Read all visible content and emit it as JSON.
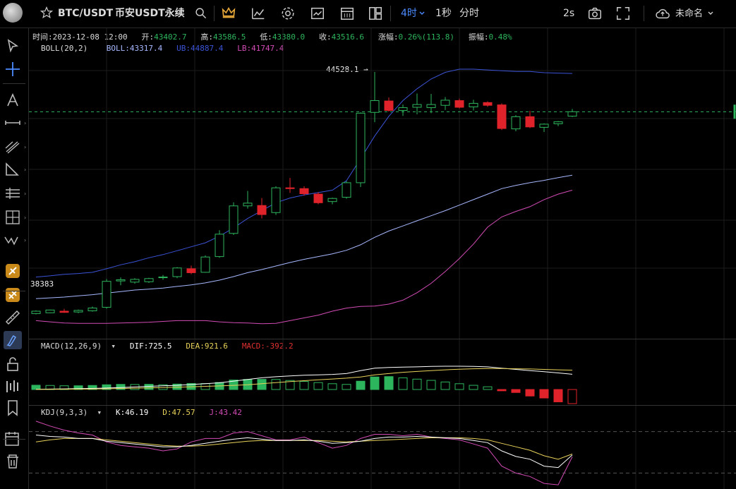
{
  "header": {
    "symbol": "BTC/USDT",
    "exchange": "币安USDT永续",
    "intervals": [
      {
        "label": "4时",
        "active": true,
        "has_dropdown": true
      },
      {
        "label": "1秒",
        "active": false
      },
      {
        "label": "分时",
        "active": false
      }
    ],
    "refresh": "2s",
    "layout_name": "未命名",
    "icons": [
      "star-icon",
      "search-icon",
      "crown-icon",
      "indicators-icon",
      "gear-icon",
      "chart-template-icon",
      "calendar-icon",
      "layout-icon",
      "camera-icon",
      "fullscreen-icon",
      "cloud-icon",
      "chevron-down-icon"
    ]
  },
  "ohlc": {
    "time_label": "时间:",
    "time": "2023-12-08 12:00",
    "open_label": "开:",
    "open": "43402.7",
    "high_label": "高:",
    "high": "43586.5",
    "low_label": "低:",
    "low": "43380.0",
    "close_label": "收:",
    "close": "43516.6",
    "change_label": "涨幅:",
    "change": "0.26%(113.8)",
    "amp_label": "振幅:",
    "amp": "0.48%"
  },
  "boll": {
    "name": "BOLL(20,2)",
    "mid": "BOLL:43317.4",
    "ub": "UB:44887.4",
    "lb": "LB:41747.4",
    "colors": {
      "mid": "#a7b8ff",
      "ub": "#3b53d6",
      "lb": "#d24bb5"
    }
  },
  "macd": {
    "name": "MACD(12,26,9)",
    "dif": "DIF:725.5",
    "dea": "DEA:921.6",
    "macd": "MACD:-392.2",
    "colors": {
      "dif": "#ffffff",
      "dea": "#e8d25a",
      "macd": "#e03030"
    }
  },
  "kdj": {
    "name": "KDJ(9,3,3)",
    "k": "K:46.19",
    "d": "D:47.57",
    "j": "J:43.42",
    "colors": {
      "k": "#ffffff",
      "d": "#e8d25a",
      "j": "#d24bb5"
    }
  },
  "annotations": {
    "high_mark": "44528.1",
    "low_mark": "38383"
  },
  "colors": {
    "up": "#2db55d",
    "down": "#e0222a",
    "bg": "#000000"
  },
  "left_tools": [
    "cursor-icon",
    "crosshair-icon",
    "text-icon",
    "line-icon",
    "multi-line-icon",
    "triangle-icon",
    "fib-icon",
    "gann-icon",
    "wave-icon",
    "magnet-icon",
    "magnet-strong-icon",
    "ruler-icon",
    "pen-icon",
    "lock-icon",
    "group-icon",
    "bookmark-icon",
    "calendar-edit-icon",
    "trash-icon"
  ],
  "chart_data": {
    "type": "candlestick",
    "series": [
      {
        "name": "candles",
        "values": [
          [
            38380,
            38460,
            38360,
            38440
          ],
          [
            38400,
            38480,
            38390,
            38470
          ],
          [
            38440,
            38500,
            38400,
            38410
          ],
          [
            38420,
            38480,
            38390,
            38460
          ],
          [
            38450,
            38560,
            38430,
            38520
          ],
          [
            38540,
            39260,
            38500,
            39200
          ],
          [
            39210,
            39300,
            39100,
            39240
          ],
          [
            39180,
            39280,
            39140,
            39250
          ],
          [
            39190,
            39290,
            39160,
            39270
          ],
          [
            39300,
            39360,
            39240,
            39310
          ],
          [
            39320,
            39560,
            39280,
            39540
          ],
          [
            39520,
            39600,
            39380,
            39420
          ],
          [
            39430,
            39860,
            39420,
            39820
          ],
          [
            39830,
            40500,
            39800,
            40400
          ],
          [
            40420,
            41210,
            40380,
            41120
          ],
          [
            41120,
            41500,
            41050,
            41190
          ],
          [
            41130,
            41320,
            40800,
            40900
          ],
          [
            40950,
            41620,
            40890,
            41580
          ],
          [
            41580,
            41830,
            41450,
            41560
          ],
          [
            41560,
            41620,
            41380,
            41430
          ],
          [
            41420,
            41470,
            41160,
            41200
          ],
          [
            41230,
            41330,
            41160,
            41310
          ],
          [
            41340,
            41750,
            41300,
            41710
          ],
          [
            41710,
            43500,
            41600,
            43480
          ],
          [
            43500,
            44528,
            43250,
            43800
          ],
          [
            43790,
            43880,
            43520,
            43550
          ],
          [
            43550,
            43700,
            43410,
            43620
          ],
          [
            43630,
            43980,
            43450,
            43700
          ],
          [
            43620,
            43970,
            43480,
            43700
          ],
          [
            43680,
            43890,
            43560,
            43810
          ],
          [
            43800,
            43850,
            43600,
            43630
          ],
          [
            43640,
            43820,
            43550,
            43730
          ],
          [
            43750,
            43780,
            43640,
            43680
          ],
          [
            43690,
            43730,
            43050,
            43090
          ],
          [
            43080,
            43430,
            43020,
            43390
          ],
          [
            43390,
            43540,
            43100,
            43130
          ],
          [
            43120,
            43220,
            43000,
            43200
          ],
          [
            43210,
            43280,
            43150,
            43260
          ],
          [
            43402.7,
            43586.5,
            43380,
            43516.6
          ]
        ]
      },
      {
        "name": "UB",
        "values": [
          39310,
          39340,
          39380,
          39400,
          39430,
          39520,
          39620,
          39700,
          39800,
          39880,
          39980,
          40080,
          40180,
          40350,
          40560,
          40800,
          41000,
          41200,
          41320,
          41400,
          41460,
          41520,
          41760,
          42320,
          42900,
          43400,
          43800,
          44100,
          44350,
          44520,
          44600,
          44600,
          44580,
          44560,
          44540,
          44540,
          44510,
          44500,
          44490
        ]
      },
      {
        "name": "BOLL",
        "values": [
          38760,
          38780,
          38800,
          38830,
          38860,
          38900,
          38940,
          38980,
          39000,
          39030,
          39070,
          39110,
          39160,
          39230,
          39320,
          39420,
          39500,
          39590,
          39680,
          39760,
          39830,
          39900,
          39990,
          40130,
          40320,
          40480,
          40610,
          40740,
          40870,
          41000,
          41140,
          41280,
          41420,
          41560,
          41640,
          41710,
          41770,
          41840,
          41900
        ]
      },
      {
        "name": "LB",
        "values": [
          38200,
          38170,
          38140,
          38130,
          38130,
          38130,
          38140,
          38150,
          38160,
          38180,
          38200,
          38200,
          38200,
          38170,
          38150,
          38140,
          38120,
          38130,
          38200,
          38270,
          38340,
          38440,
          38520,
          38560,
          38570,
          38620,
          38720,
          38910,
          39150,
          39450,
          39780,
          40150,
          40580,
          40840,
          40980,
          41100,
          41280,
          41420,
          41520
        ]
      },
      {
        "name": "MACD_hist",
        "values": [
          56,
          53,
          49,
          49,
          53,
          62,
          67,
          66,
          68,
          62,
          71,
          79,
          78,
          92,
          124,
          132,
          133,
          132,
          118,
          106,
          91,
          76,
          67,
          109,
          164,
          169,
          153,
          136,
          120,
          99,
          76,
          55,
          36,
          -17,
          -39,
          -85,
          -111,
          -162,
          -185
        ]
      },
      {
        "name": "DIF",
        "values": [
          10,
          20,
          30,
          40,
          50,
          70,
          95,
          120,
          150,
          175,
          200,
          240,
          280,
          320,
          400,
          480,
          560,
          610,
          650,
          680,
          700,
          720,
          760,
          900,
          1020,
          1050,
          1070,
          1080,
          1100,
          1110,
          1110,
          1100,
          1080,
          1020,
          960,
          900,
          850,
          790,
          725.5
        ]
      },
      {
        "name": "DEA",
        "values": [
          5,
          10,
          15,
          20,
          25,
          35,
          50,
          65,
          80,
          95,
          110,
          130,
          150,
          170,
          200,
          230,
          280,
          330,
          380,
          420,
          460,
          500,
          540,
          600,
          700,
          760,
          820,
          860,
          900,
          940,
          970,
          990,
          1000,
          1000,
          990,
          980,
          960,
          940,
          921.6
        ]
      },
      {
        "name": "K",
        "values": [
          75,
          73,
          72,
          70,
          70,
          66,
          64,
          62,
          60,
          58,
          58,
          60,
          63,
          66,
          69,
          71,
          69,
          67,
          67,
          68,
          66,
          63,
          64,
          66,
          70,
          72,
          72,
          73,
          72,
          71,
          70,
          67,
          64,
          52,
          44,
          40,
          30,
          28,
          46.19
        ]
      },
      {
        "name": "D",
        "values": [
          65,
          68,
          70,
          70,
          70,
          68,
          66,
          64,
          62,
          60,
          59,
          59,
          60,
          62,
          64,
          66,
          67,
          67,
          67,
          67,
          67,
          66,
          65,
          66,
          67,
          68,
          69,
          70,
          71,
          71,
          71,
          70,
          68,
          63,
          58,
          53,
          45,
          40,
          47.57
        ]
      },
      {
        "name": "J",
        "values": [
          95,
          88,
          82,
          78,
          75,
          65,
          60,
          58,
          56,
          52,
          55,
          65,
          70,
          70,
          78,
          80,
          74,
          68,
          68,
          72,
          64,
          56,
          60,
          70,
          76,
          76,
          74,
          76,
          72,
          70,
          68,
          62,
          56,
          30,
          20,
          15,
          5,
          3,
          43.42
        ]
      }
    ]
  }
}
